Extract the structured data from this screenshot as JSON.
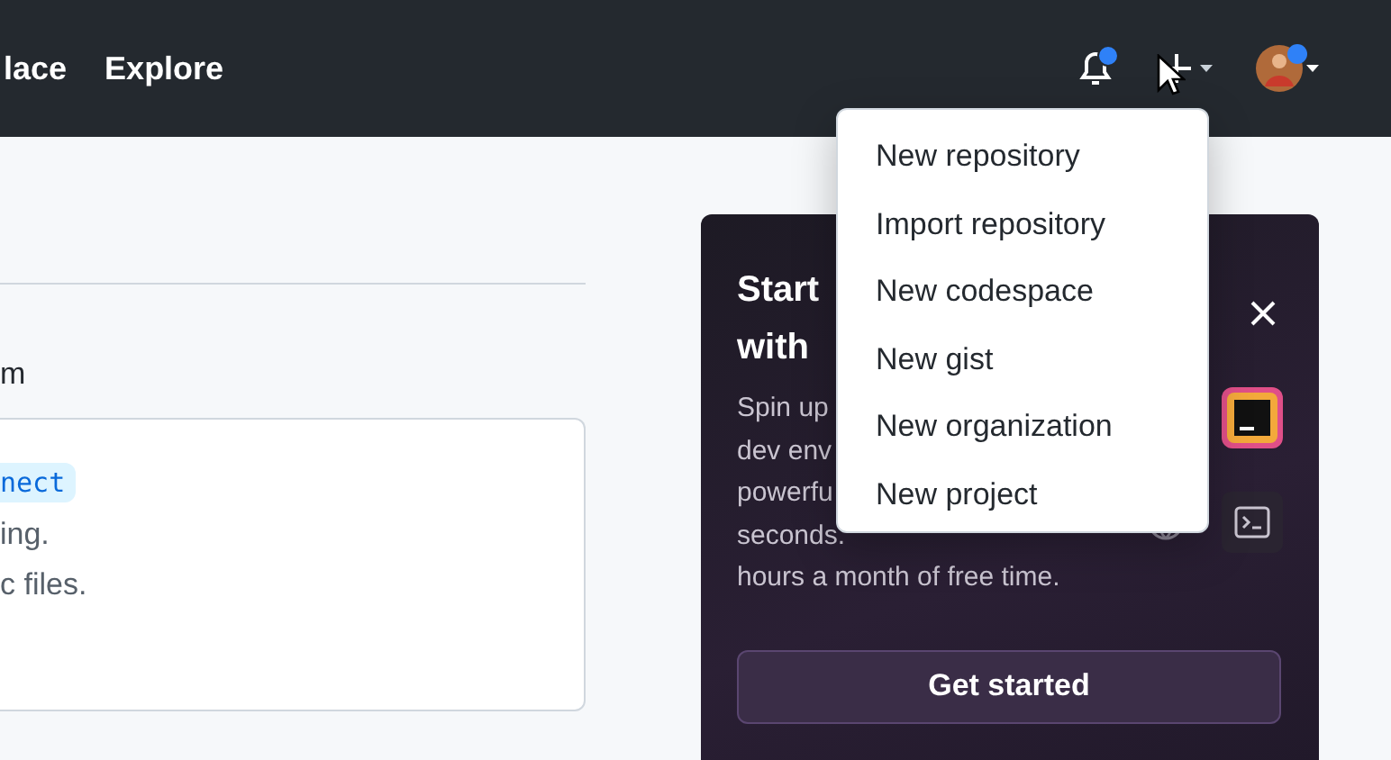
{
  "header": {
    "links": [
      {
        "label": "lace"
      },
      {
        "label": "Explore"
      }
    ],
    "notifications": {
      "unread": true
    }
  },
  "content": {
    "fragment": "m",
    "card": {
      "code_chip": "nect",
      "lines": [
        "ing.",
        "c files."
      ]
    }
  },
  "promo": {
    "title_lines": [
      "Start",
      "with"
    ],
    "description_lines": [
      "Spin up",
      "dev env",
      "powerfu",
      "seconds.",
      "hours a month of free time."
    ],
    "button": "Get started"
  },
  "create_menu": {
    "items": [
      {
        "label": "New repository"
      },
      {
        "label": "Import repository"
      },
      {
        "label": "New codespace"
      },
      {
        "label": "New gist"
      },
      {
        "label": "New organization"
      },
      {
        "label": "New project"
      }
    ]
  }
}
